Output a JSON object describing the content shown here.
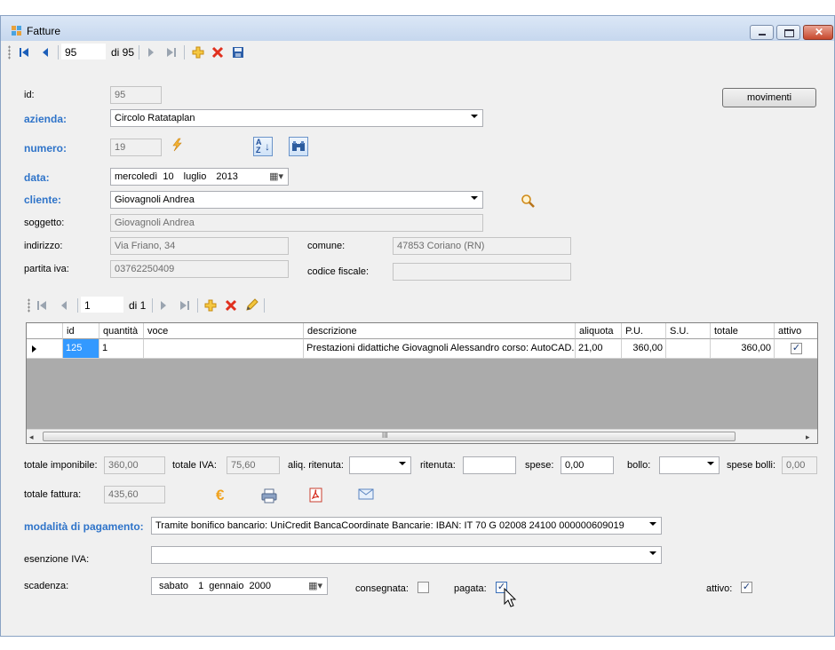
{
  "window": {
    "title": "Fatture"
  },
  "nav_main": {
    "position": "95",
    "count": "di 95"
  },
  "nav_detail": {
    "position": "1",
    "count": "di 1"
  },
  "buttons": {
    "movimenti": "movimenti"
  },
  "form": {
    "id_label": "id:",
    "id_value": "95",
    "azienda_label": "azienda:",
    "azienda_value": "Circolo Ratataplan",
    "numero_label": "numero:",
    "numero_value": "19",
    "data_label": "data:",
    "data_day": "mercoledì",
    "data_d": "10",
    "data_month": "luglio",
    "data_year": "2013",
    "cliente_label": "cliente:",
    "cliente_value": "Giovagnoli Andrea",
    "soggetto_label": "soggetto:",
    "soggetto_value": "Giovagnoli Andrea",
    "indirizzo_label": "indirizzo:",
    "indirizzo_value": "Via Friano, 34",
    "comune_label": "comune:",
    "comune_value": "47853 Coriano (RN)",
    "piva_label": "partita iva:",
    "piva_value": "03762250409",
    "cf_label": "codice fiscale:",
    "cf_value": ""
  },
  "grid": {
    "columns": [
      "id",
      "quantità",
      "voce",
      "descrizione",
      "aliquota",
      "P.U.",
      "S.U.",
      "totale",
      "attivo"
    ],
    "row": {
      "id": "125",
      "quantita": "1",
      "voce": "",
      "descrizione": "Prestazioni didattiche Giovagnoli Alessandro corso: AutoCAD...",
      "aliquota": "21,00",
      "pu": "360,00",
      "su": "",
      "totale": "360,00",
      "attivo": true
    },
    "scroll_mark": "III"
  },
  "totals": {
    "imponibile_label": "totale imponibile:",
    "imponibile_value": "360,00",
    "iva_label": "totale IVA:",
    "iva_value": "75,60",
    "aliq_rit_label": "aliq. ritenuta:",
    "aliq_rit_value": "",
    "ritenuta_label": "ritenuta:",
    "ritenuta_value": "",
    "spese_label": "spese:",
    "spese_value": "0,00",
    "bollo_label": "bollo:",
    "bollo_value": "",
    "spese_bolli_label": "spese bolli:",
    "spese_bolli_value": "0,00",
    "fattura_label": "totale fattura:",
    "fattura_value": "435,60"
  },
  "payment": {
    "modalita_label": "modalità di pagamento:",
    "modalita_value": "Tramite bonifico bancario: UniCredit BancaCoordinate Bancarie: IBAN: IT 70 G 02008 24100 000000609019",
    "esenzione_label": "esenzione IVA:",
    "esenzione_value": "",
    "scadenza_label": "scadenza:",
    "scad_day": "sabato",
    "scad_d": "1",
    "scad_month": "gennaio",
    "scad_year": "2000",
    "consegnata_label": "consegnata:",
    "consegnata": false,
    "pagata_label": "pagata:",
    "pagata": true,
    "attivo_label": "attivo:",
    "attivo": true
  },
  "colors": {
    "accent_label": "#2f74c9",
    "selected_cell": "#3399ff",
    "grid_empty": "#ababab"
  }
}
